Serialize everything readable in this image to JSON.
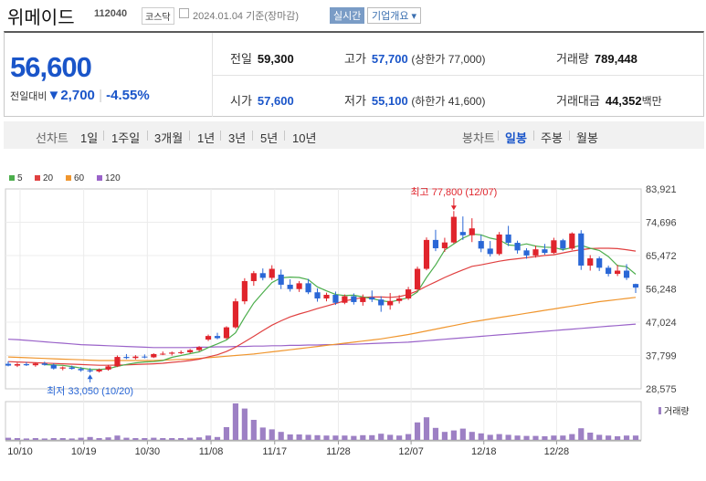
{
  "header": {
    "name": "위메이드",
    "code": "112040",
    "market": "코스닥",
    "date": "2024.01.04 기준(장마감)",
    "realtime": "실시간",
    "company_info": "기업개요 ▾"
  },
  "quote": {
    "price": "56,600",
    "change_label": "전일대비",
    "change_arrow": "▼",
    "change_value": "2,700",
    "change_sep": "|",
    "change_pct": "-4.55%",
    "items": {
      "prev_close": {
        "label": "전일",
        "value": "59,300"
      },
      "high": {
        "label": "고가",
        "value": "57,700",
        "sub": "(상한가 77,000)"
      },
      "volume": {
        "label": "거래량",
        "value": "789,448"
      },
      "open": {
        "label": "시가",
        "value": "57,600"
      },
      "low": {
        "label": "저가",
        "value": "55,100",
        "sub": "(하한가 41,600)"
      },
      "trade_value": {
        "label": "거래대금",
        "value": "44,352",
        "unit": "백만"
      }
    }
  },
  "period_tabs": {
    "line_label": "선차트",
    "line": [
      "1일",
      "1주일",
      "3개월",
      "1년",
      "3년",
      "5년",
      "10년"
    ],
    "candle_label": "봉차트",
    "candle": [
      "일봉",
      "주봉",
      "월봉"
    ],
    "active": "일봉"
  },
  "chart_data": {
    "type": "candlestick",
    "ma_legend": [
      {
        "label": "5",
        "color": "#4cae4c"
      },
      {
        "label": "20",
        "color": "#e04040"
      },
      {
        "label": "60",
        "color": "#f0962e"
      },
      {
        "label": "120",
        "color": "#9a63c9"
      }
    ],
    "y_ticks": [
      "83,921",
      "74,696",
      "65,472",
      "56,248",
      "47,024",
      "37,799",
      "28,575"
    ],
    "ylim": [
      28575,
      83921
    ],
    "x_ticks": [
      "10/10",
      "10/19",
      "10/30",
      "11/08",
      "11/17",
      "11/28",
      "12/07",
      "12/18",
      "12/28"
    ],
    "high_annotation": "최고 77,800 (12/07)",
    "low_annotation": "최저 33,050 (10/20)",
    "volume_label": "거래량",
    "candles": [
      [
        35500,
        36200,
        34800,
        35000
      ],
      [
        35000,
        35800,
        34600,
        35400
      ],
      [
        35400,
        36000,
        34900,
        35100
      ],
      [
        35100,
        35900,
        34700,
        35600
      ],
      [
        35600,
        36100,
        35000,
        35200
      ],
      [
        35200,
        35600,
        33900,
        34200
      ],
      [
        34200,
        34800,
        33700,
        34500
      ],
      [
        34500,
        35000,
        33900,
        34100
      ],
      [
        34100,
        34600,
        33300,
        33700
      ],
      [
        33700,
        34300,
        33050,
        33400
      ],
      [
        33400,
        34200,
        33100,
        33900
      ],
      [
        33900,
        35200,
        33600,
        34800
      ],
      [
        34800,
        37800,
        34600,
        37400
      ],
      [
        37400,
        38200,
        36800,
        37100
      ],
      [
        37100,
        37900,
        36700,
        37500
      ],
      [
        37500,
        38100,
        37000,
        37300
      ],
      [
        37300,
        38400,
        37100,
        38200
      ],
      [
        38200,
        38900,
        37900,
        38300
      ],
      [
        38300,
        38900,
        37800,
        38600
      ],
      [
        38600,
        39200,
        38200,
        38700
      ],
      [
        38700,
        39600,
        38400,
        39300
      ],
      [
        39300,
        40400,
        38900,
        40100
      ],
      [
        42200,
        43600,
        41800,
        43200
      ],
      [
        43200,
        44100,
        42300,
        42600
      ],
      [
        42600,
        45900,
        42300,
        45600
      ],
      [
        45600,
        53600,
        45200,
        52800
      ],
      [
        52800,
        59200,
        52000,
        58400
      ],
      [
        58400,
        61200,
        57100,
        60600
      ],
      [
        60600,
        61900,
        58600,
        59300
      ],
      [
        59300,
        62800,
        58700,
        61800
      ],
      [
        60200,
        61600,
        56200,
        57400
      ],
      [
        57400,
        58900,
        55500,
        56200
      ],
      [
        56200,
        58400,
        55400,
        57800
      ],
      [
        57800,
        59000,
        54800,
        55300
      ],
      [
        55300,
        56400,
        52700,
        53600
      ],
      [
        53600,
        55200,
        52800,
        54600
      ],
      [
        54600,
        55500,
        51800,
        52400
      ],
      [
        52400,
        54700,
        52000,
        54200
      ],
      [
        54200,
        55000,
        51900,
        52600
      ],
      [
        52600,
        54700,
        51600,
        53900
      ],
      [
        53900,
        55800,
        52600,
        53300
      ],
      [
        53300,
        54200,
        49900,
        51700
      ],
      [
        51700,
        55100,
        50500,
        52900
      ],
      [
        52900,
        54500,
        52200,
        53600
      ],
      [
        53600,
        56800,
        53200,
        56100
      ],
      [
        56100,
        62400,
        55900,
        61800
      ],
      [
        61800,
        70500,
        61400,
        69800
      ],
      [
        69800,
        72600,
        66700,
        67500
      ],
      [
        67500,
        70400,
        66500,
        69100
      ],
      [
        69100,
        77800,
        68800,
        76200
      ],
      [
        72000,
        76300,
        69800,
        71100
      ],
      [
        71100,
        75800,
        69200,
        73000
      ],
      [
        69500,
        71200,
        66400,
        67400
      ],
      [
        67400,
        69500,
        65200,
        65900
      ],
      [
        65900,
        72000,
        65500,
        71300
      ],
      [
        71300,
        73700,
        68100,
        69000
      ],
      [
        69000,
        69600,
        66000,
        66900
      ],
      [
        66900,
        67500,
        64600,
        65500
      ],
      [
        65500,
        68200,
        64900,
        67200
      ],
      [
        67200,
        68700,
        65700,
        66200
      ],
      [
        66200,
        70400,
        65900,
        69700
      ],
      [
        69700,
        70100,
        66800,
        67400
      ],
      [
        67400,
        71900,
        67000,
        71600
      ],
      [
        71600,
        72500,
        61500,
        62700
      ],
      [
        62700,
        65600,
        61300,
        64700
      ],
      [
        64700,
        65200,
        61200,
        62100
      ],
      [
        62100,
        62700,
        59700,
        60400
      ],
      [
        60400,
        62900,
        59800,
        61300
      ],
      [
        61300,
        63100,
        58700,
        59300
      ],
      [
        57600,
        57700,
        55100,
        56600
      ]
    ],
    "volumes": [
      0.06,
      0.05,
      0.04,
      0.05,
      0.04,
      0.05,
      0.05,
      0.04,
      0.06,
      0.08,
      0.05,
      0.07,
      0.12,
      0.06,
      0.05,
      0.05,
      0.06,
      0.05,
      0.05,
      0.05,
      0.06,
      0.07,
      0.12,
      0.08,
      0.35,
      1.0,
      0.86,
      0.55,
      0.34,
      0.29,
      0.22,
      0.15,
      0.15,
      0.14,
      0.13,
      0.12,
      0.12,
      0.12,
      0.11,
      0.13,
      0.13,
      0.17,
      0.14,
      0.12,
      0.16,
      0.48,
      0.62,
      0.33,
      0.22,
      0.26,
      0.31,
      0.22,
      0.18,
      0.14,
      0.16,
      0.14,
      0.12,
      0.11,
      0.11,
      0.1,
      0.12,
      0.12,
      0.16,
      0.32,
      0.2,
      0.14,
      0.12,
      0.1,
      0.12,
      0.12
    ],
    "ma5": [
      null,
      null,
      null,
      null,
      35260,
      35180,
      35060,
      34740,
      34340,
      33980,
      33920,
      34140,
      34800,
      35320,
      35740,
      36000,
      36100,
      36400,
      37300,
      37800,
      38300,
      38800,
      40000,
      41000,
      42100,
      44100,
      48400,
      52300,
      55200,
      58000,
      59300,
      59500,
      59400,
      58800,
      56800,
      55700,
      54700,
      54400,
      54500,
      54000,
      53600,
      53000,
      52600,
      53200,
      53800,
      55400,
      59400,
      62900,
      67000,
      68700,
      70300,
      71400,
      71200,
      70300,
      69800,
      68400,
      68200,
      68700,
      68100,
      67800,
      67700,
      67100,
      67700,
      68300,
      67500,
      66900,
      65200,
      62700,
      62400,
      60300
    ],
    "ma20": [
      36100,
      36000,
      35900,
      35800,
      35700,
      35600,
      35500,
      35400,
      35300,
      35200,
      35100,
      35100,
      35150,
      35200,
      35300,
      35400,
      35500,
      35650,
      35900,
      36100,
      36400,
      36800,
      37400,
      38000,
      38900,
      40100,
      41600,
      43100,
      44700,
      46200,
      47400,
      48500,
      49300,
      50000,
      50800,
      51500,
      52200,
      52900,
      53400,
      53900,
      54000,
      54000,
      53900,
      54100,
      54700,
      55700,
      57000,
      58200,
      59400,
      60500,
      61500,
      62500,
      62900,
      63400,
      63900,
      64300,
      64600,
      64900,
      65200,
      65500,
      65700,
      66200,
      66700,
      67100,
      67400,
      67500,
      67500,
      67400,
      67100,
      66700
    ],
    "ma60": [
      37400,
      37300,
      37200,
      37100,
      37000,
      36900,
      36800,
      36700,
      36600,
      36500,
      36400,
      36400,
      36400,
      36400,
      36400,
      36400,
      36400,
      36500,
      36600,
      36700,
      36800,
      37000,
      37200,
      37400,
      37600,
      37800,
      38000,
      38200,
      38500,
      38800,
      39100,
      39400,
      39700,
      40000,
      40300,
      40600,
      40900,
      41200,
      41500,
      41800,
      42100,
      42400,
      42800,
      43200,
      43600,
      44100,
      44600,
      45100,
      45600,
      46100,
      46600,
      47100,
      47500,
      47900,
      48300,
      48700,
      49100,
      49500,
      49900,
      50300,
      50700,
      51100,
      51500,
      51900,
      52300,
      52700,
      53000,
      53300,
      53600,
      53900
    ],
    "ma120": [
      42300,
      42200,
      42000,
      41800,
      41600,
      41400,
      41200,
      41000,
      40800,
      40700,
      40600,
      40500,
      40400,
      40300,
      40200,
      40100,
      40000,
      40000,
      40000,
      40000,
      40000,
      40100,
      40100,
      40200,
      40200,
      40300,
      40300,
      40400,
      40400,
      40500,
      40500,
      40600,
      40600,
      40700,
      40700,
      40800,
      40800,
      40900,
      40900,
      41000,
      41100,
      41200,
      41300,
      41400,
      41500,
      41700,
      41900,
      42100,
      42300,
      42500,
      42700,
      42900,
      43100,
      43300,
      43500,
      43700,
      43900,
      44100,
      44300,
      44500,
      44700,
      44900,
      45100,
      45300,
      45500,
      45700,
      45900,
      46100,
      46300,
      46500
    ]
  }
}
